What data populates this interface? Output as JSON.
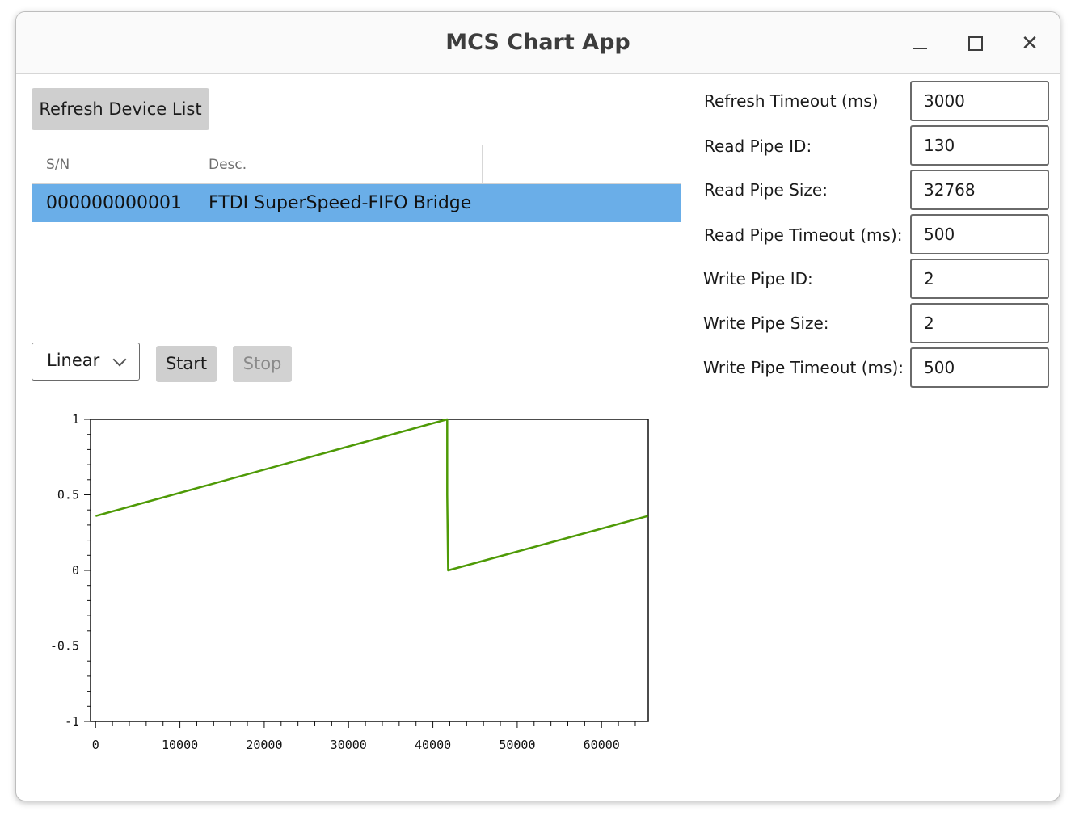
{
  "window": {
    "title": "MCS Chart App",
    "controls": {
      "minimize": "–",
      "maximize": "□",
      "close": "✕"
    }
  },
  "toolbar": {
    "refresh_label": "Refresh Device List"
  },
  "device_table": {
    "columns": [
      "S/N",
      "Desc.",
      ""
    ],
    "rows": [
      {
        "sn": "000000000001",
        "desc": "FTDI SuperSpeed-FIFO Bridge",
        "selected": true
      }
    ],
    "selected_color": "#6aaee8"
  },
  "controls": {
    "mode_select": {
      "value": "Linear"
    },
    "start_label": "Start",
    "stop_label": "Stop"
  },
  "settings": {
    "refresh_timeout_label": "Refresh Timeout (ms)",
    "refresh_timeout_value": "3000",
    "read_pipe_id_label": "Read Pipe ID:",
    "read_pipe_id_value": "130",
    "read_pipe_size_label": "Read Pipe Size:",
    "read_pipe_size_value": "32768",
    "read_pipe_timeout_label": "Read Pipe Timeout (ms):",
    "read_pipe_timeout_value": "500",
    "write_pipe_id_label": "Write Pipe ID:",
    "write_pipe_id_value": "2",
    "write_pipe_size_label": "Write Pipe Size:",
    "write_pipe_size_value": "2",
    "write_pipe_timeout_label": "Write Pipe Timeout (ms):",
    "write_pipe_timeout_value": "500"
  },
  "chart_data": {
    "type": "line",
    "title": "",
    "xlabel": "",
    "ylabel": "",
    "xlim": [
      -600,
      65536
    ],
    "ylim": [
      -1,
      1
    ],
    "xticks": [
      0,
      10000,
      20000,
      30000,
      40000,
      50000,
      60000
    ],
    "xtick_labels": [
      "0",
      "10000",
      "20000",
      "30000",
      "40000",
      "50000",
      "60000"
    ],
    "yticks": [
      1,
      0.5,
      0,
      -0.5,
      -1
    ],
    "ytick_labels": [
      "1",
      "0.5",
      "0",
      "-0.5",
      "-1"
    ],
    "grid": false,
    "series": [
      {
        "color": "#4e9a06",
        "x": [
          0,
          41700,
          41700,
          41800,
          65500
        ],
        "y": [
          0.36,
          1.0,
          0.5,
          0.0,
          0.36
        ]
      }
    ]
  }
}
